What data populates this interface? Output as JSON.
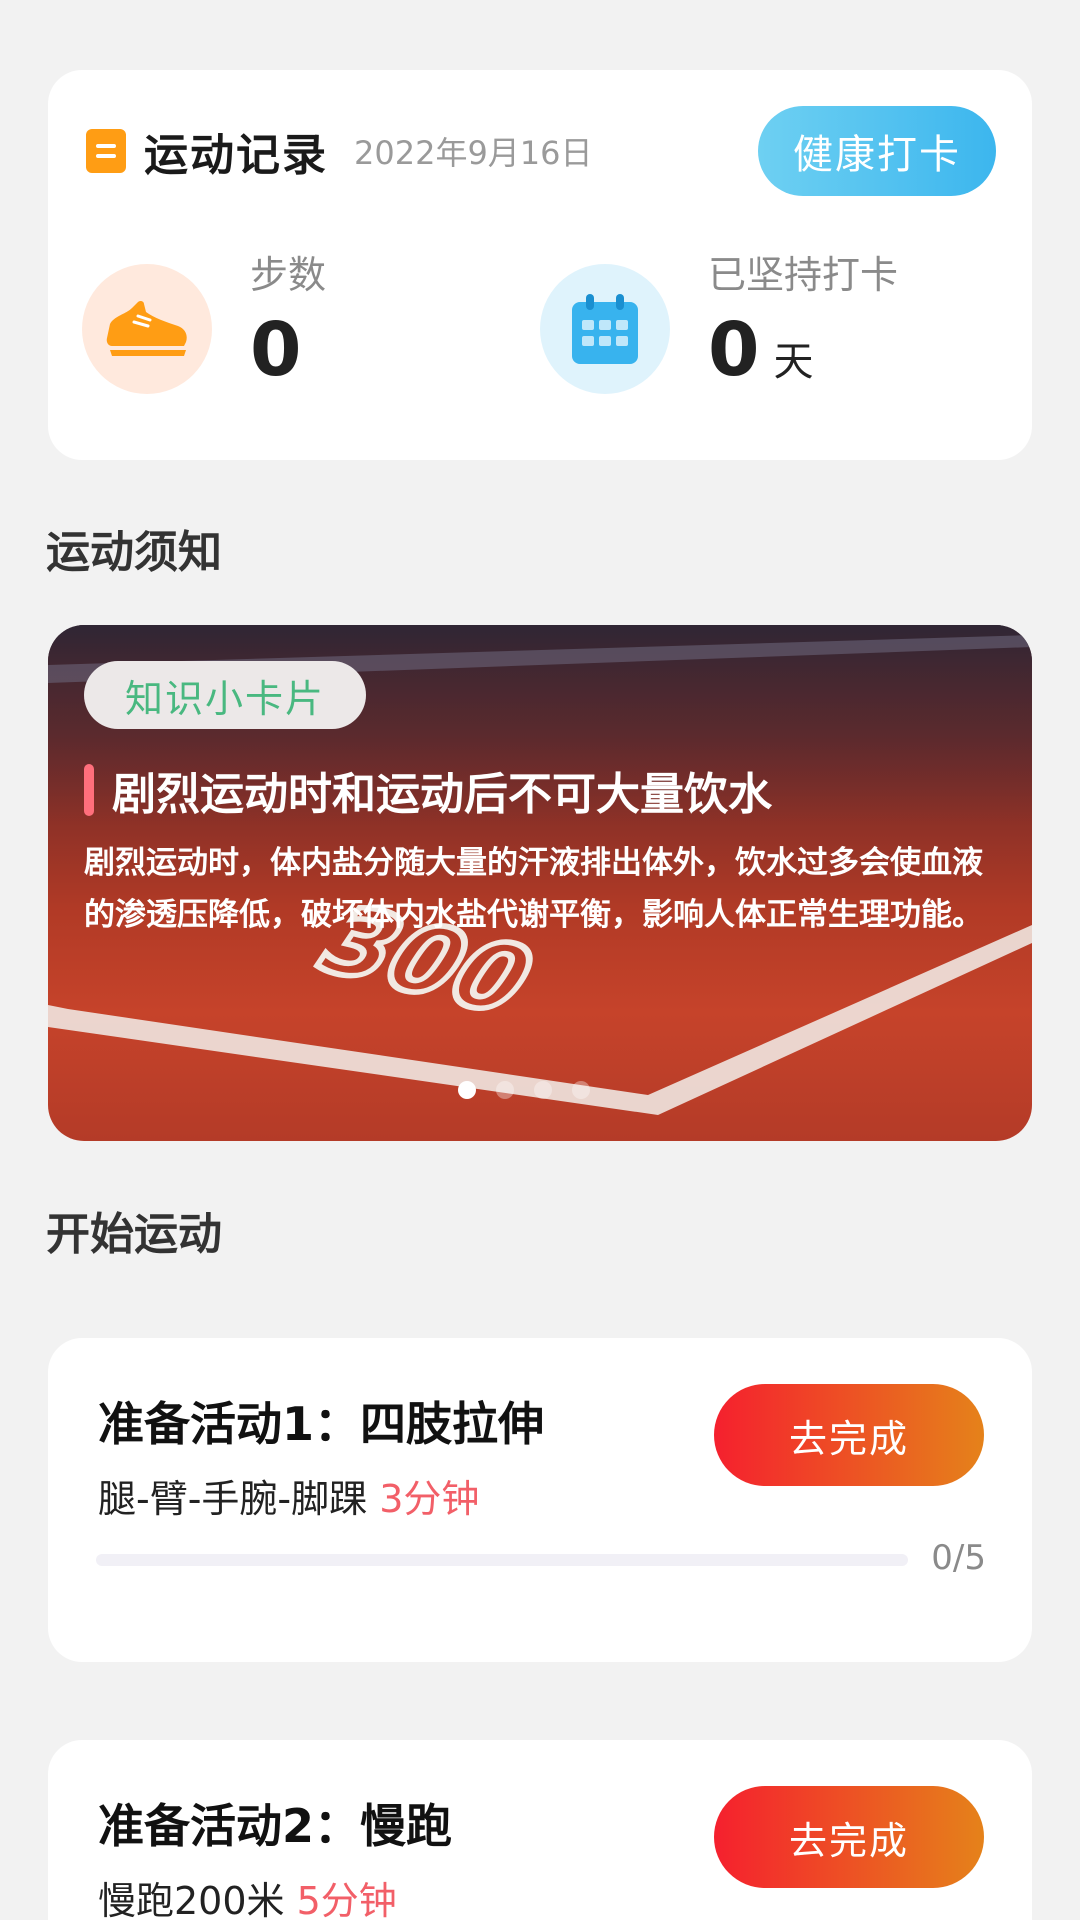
{
  "record": {
    "title": "运动记录",
    "date": "2022年9月16日",
    "checkin_button": "健康打卡",
    "steps": {
      "label": "步数",
      "value": "0",
      "icon": "sneaker-icon"
    },
    "streak": {
      "label": "已坚持打卡",
      "value": "0",
      "unit": "天",
      "icon": "calendar-icon"
    }
  },
  "notice": {
    "section_title": "运动须知",
    "tag": "知识小卡片",
    "title": "剧烈运动时和运动后不可大量饮水",
    "body": "剧烈运动时，体内盐分随大量的汗液排出体外，饮水过多会使血液的渗透压降低，破坏体内水盐代谢平衡，影响人体正常生理功能。",
    "track_number": "300",
    "carousel": {
      "count": 4,
      "active": 0
    }
  },
  "exercise": {
    "section_title": "开始运动",
    "tasks": [
      {
        "title": "准备活动1：四肢拉伸",
        "detail": "腿-臂-手腕-脚踝",
        "duration": "3分钟",
        "button": "去完成",
        "progress_text": "0/5",
        "progress": 0
      },
      {
        "title": "准备活动2：慢跑",
        "detail": "慢跑200米",
        "duration": "5分钟",
        "button": "去完成"
      }
    ]
  },
  "colors": {
    "accent_blue": "#3cb6ee",
    "accent_orange": "#ff9d14",
    "accent_red": "#f25f68",
    "tag_green": "#49b880"
  }
}
